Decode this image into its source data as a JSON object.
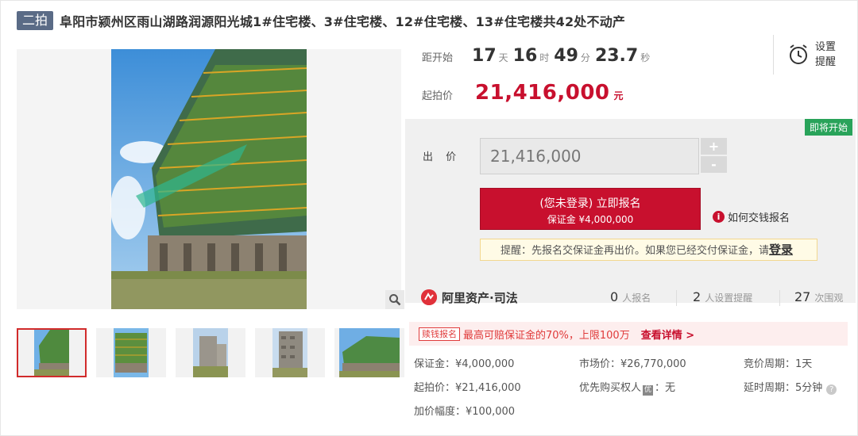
{
  "header": {
    "round_badge": "二拍",
    "title": "阜阳市颍州区雨山湖路润源阳光城1#住宅楼、3#住宅楼、12#住宅楼、13#住宅楼共42处不动产"
  },
  "countdown": {
    "label": "距开始",
    "days": "17",
    "days_unit": "天",
    "hours": "16",
    "hours_unit": "时",
    "minutes": "49",
    "minutes_unit": "分",
    "seconds": "23.7",
    "seconds_unit": "秒"
  },
  "reminder": {
    "label_line1": "设置",
    "label_line2": "提醒",
    "icon": "alarm-clock-icon"
  },
  "start_price": {
    "label": "起拍价",
    "value": "21,416,000",
    "unit": "元"
  },
  "bid": {
    "status_tag": "即将开始",
    "label": "出 价",
    "input_value": "21,416,000",
    "plus": "+",
    "minus": "-",
    "register_main": "(您未登录) 立即报名",
    "register_sub": "保证金 ¥4,000,000",
    "howto_label": "如何交钱报名",
    "tip_text": "提醒：先报名交保证金再出价。如果您已经交付保证金，请",
    "tip_link": "登录"
  },
  "platform": {
    "brand": "阿里资产·司法",
    "registered_count": "0",
    "registered_label": "人报名",
    "reminder_count": "2",
    "reminder_label": "人设置提醒",
    "view_count": "27",
    "view_label": "次围观"
  },
  "promo": {
    "tag": "赎钱报名",
    "text": "最高可赔保证金的70%，上限100万",
    "link": "查看详情 >"
  },
  "details": {
    "deposit": "保证金：¥4,000,000",
    "market_price": "市场价：¥26,770,000",
    "bidding_period": "竞价周期：1天",
    "start_price": "起拍价：¥21,416,000",
    "priority_prefix": "优先购买权人",
    "priority_icon": "优",
    "priority_suffix": "：无",
    "delay_period": "延时周期：5分钟",
    "increment": "加价幅度：¥100,000"
  },
  "colors": {
    "accent_red": "#c8102e",
    "badge_gray": "#5a6b86",
    "status_green": "#29a35a",
    "panel_gray": "#f0f0f0"
  }
}
